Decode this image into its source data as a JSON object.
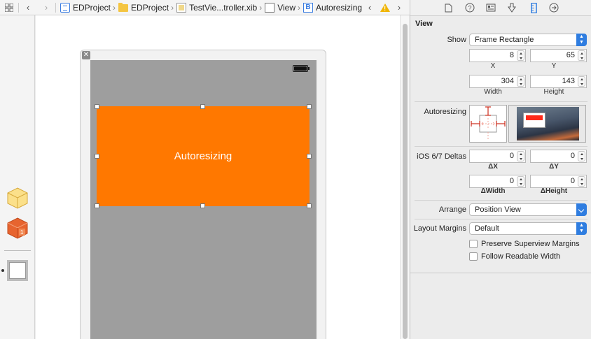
{
  "jumpbar": {
    "crumbs": [
      {
        "label": "EDProject",
        "icon": "project-icon"
      },
      {
        "label": "EDProject",
        "icon": "folder-icon"
      },
      {
        "label": "TestVie...troller.xib",
        "icon": "xib-file-icon"
      },
      {
        "label": "View",
        "icon": "view-icon"
      },
      {
        "label": "Autoresizing",
        "icon": "button-b-icon"
      }
    ]
  },
  "canvas": {
    "orange_view_label": "Autoresizing",
    "colors": {
      "orange": "#ff7800",
      "screen": "#9e9e9e"
    }
  },
  "inspector": {
    "section_title": "View",
    "show_label": "Show",
    "show_value": "Frame Rectangle",
    "x_value": "8",
    "y_value": "65",
    "x_label": "X",
    "y_label": "Y",
    "width_value": "304",
    "height_value": "143",
    "width_label": "Width",
    "height_label": "Height",
    "autoresizing_label": "Autoresizing",
    "deltas_label": "iOS 6/7 Deltas",
    "dx_value": "0",
    "dy_value": "0",
    "dx_label": "ΔX",
    "dy_label": "ΔY",
    "dwidth_value": "0",
    "dheight_value": "0",
    "dwidth_label": "ΔWidth",
    "dheight_label": "ΔHeight",
    "arrange_label": "Arrange",
    "arrange_value": "Position View",
    "layout_margins_label": "Layout Margins",
    "layout_margins_value": "Default",
    "preserve_label": "Preserve Superview Margins",
    "readable_label": "Follow Readable Width",
    "accent": "#2f7de0"
  }
}
